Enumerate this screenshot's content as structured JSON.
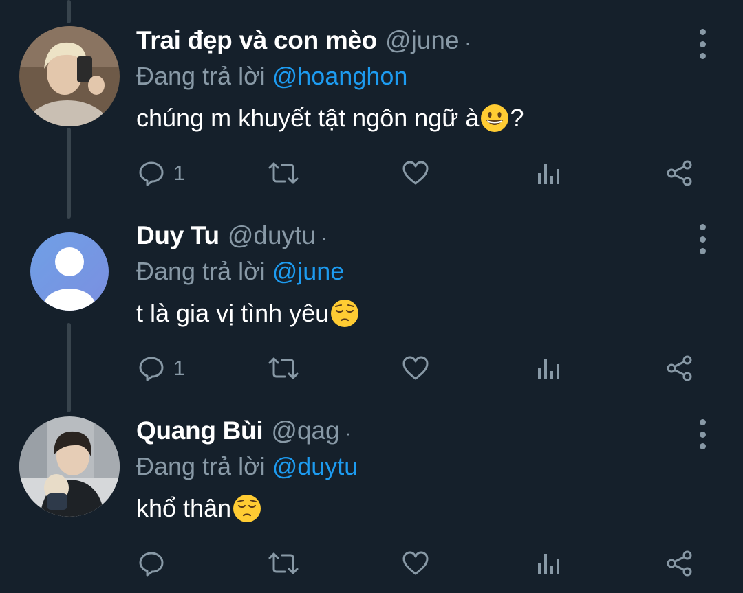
{
  "reply_prefix": "Đang trả lời",
  "tweets": [
    {
      "name": "Trai đẹp và con mèo",
      "handle": "@june",
      "separator": "·",
      "reply_to": "@hoanghon",
      "text": "chúng m khuyết tật ngôn ngữ à",
      "text_suffix": "?",
      "emoji": "grinning-face",
      "reply_count": "1"
    },
    {
      "name": "Duy Tu",
      "handle": "@duytu",
      "separator": "·",
      "reply_to": "@june",
      "text": "t là gia vị tình yêu",
      "text_suffix": "",
      "emoji": "pensive-face",
      "reply_count": "1"
    },
    {
      "name": "Quang Bùi",
      "handle": "@qag",
      "separator": "·",
      "reply_to": "@duytu",
      "text": "khổ thân",
      "text_suffix": "",
      "emoji": "pensive-face",
      "reply_count": ""
    }
  ],
  "colors": {
    "background": "#15202b",
    "secondary_text": "#8899a6",
    "mention": "#1d9bf0",
    "thread_line": "#38444d"
  }
}
